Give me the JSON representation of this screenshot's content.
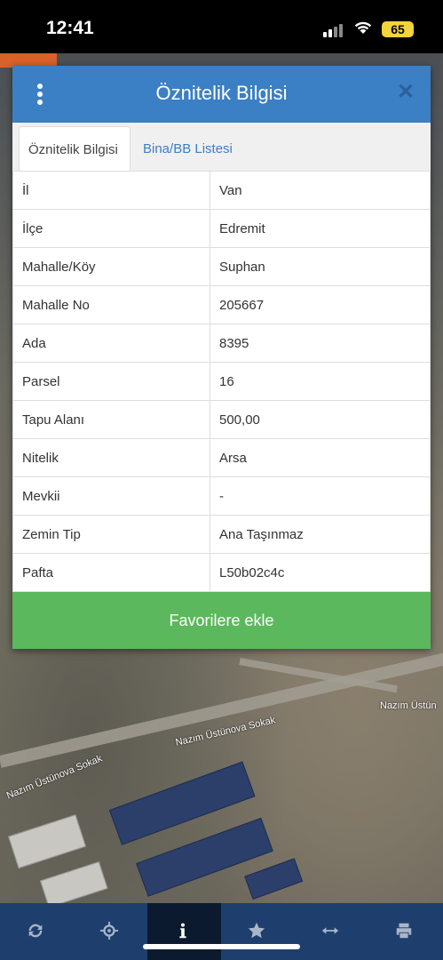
{
  "status_bar": {
    "time": "12:41",
    "battery": "65"
  },
  "modal": {
    "title": "Öznitelik Bilgisi",
    "tabs": [
      {
        "label": "Öznitelik Bilgisi",
        "active": true
      },
      {
        "label": "Bina/BB Listesi",
        "active": false
      }
    ],
    "rows": [
      {
        "key": "İl",
        "value": "Van"
      },
      {
        "key": "İlçe",
        "value": "Edremit"
      },
      {
        "key": "Mahalle/Köy",
        "value": "Suphan"
      },
      {
        "key": "Mahalle No",
        "value": "205667"
      },
      {
        "key": "Ada",
        "value": "8395"
      },
      {
        "key": "Parsel",
        "value": "16"
      },
      {
        "key": "Tapu Alanı",
        "value": "500,00"
      },
      {
        "key": "Nitelik",
        "value": "Arsa"
      },
      {
        "key": "Mevkii",
        "value": "-"
      },
      {
        "key": "Zemin Tip",
        "value": "Ana Taşınmaz"
      },
      {
        "key": "Pafta",
        "value": "L50b02c4c"
      }
    ],
    "favorite_button": "Favorilere ekle"
  },
  "map": {
    "street_labels": [
      "Nazım Üstünova Sokak",
      "Nazım Üstünova Sokak",
      "Nazım Üstün"
    ]
  },
  "toolbar": {
    "items": [
      {
        "icon": "refresh-icon"
      },
      {
        "icon": "crosshair-icon"
      },
      {
        "icon": "info-icon",
        "active": true
      },
      {
        "icon": "star-icon"
      },
      {
        "icon": "measure-icon"
      },
      {
        "icon": "print-icon"
      }
    ]
  },
  "colors": {
    "header": "#3b7fc4",
    "button": "#5cb85c",
    "toolbar": "#1e3f6e"
  }
}
